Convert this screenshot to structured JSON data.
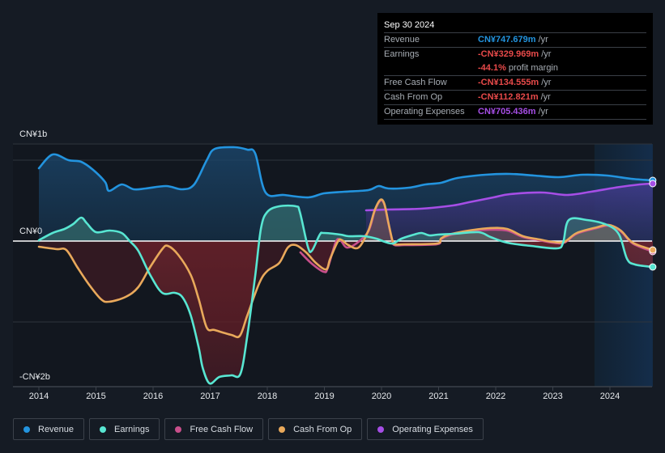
{
  "chart_data": {
    "type": "area",
    "title": "",
    "xlabel": "",
    "ylabel": "",
    "unit": "CN¥ billions",
    "xlim": [
      2014.0,
      2024.8
    ],
    "ylim": [
      -1.8,
      1.2
    ],
    "y_ticks": [
      {
        "value": 1,
        "label": "CN¥1b"
      },
      {
        "value": 0,
        "label": "CN¥0"
      },
      {
        "value": -1.7,
        "label": "-CN¥2b"
      }
    ],
    "gridlines": [
      1.2,
      1.0,
      -1.0
    ],
    "x_ticks": [
      "2014",
      "2015",
      "2016",
      "2017",
      "2018",
      "2019",
      "2020",
      "2021",
      "2022",
      "2023",
      "2024"
    ],
    "highlight_range": [
      2023.73,
      2024.75
    ],
    "legend_position": "bottom-left",
    "series": [
      {
        "name": "Revenue",
        "color": "#2394df",
        "points": [
          [
            2014.0,
            0.9
          ],
          [
            2014.24,
            1.07
          ],
          [
            2014.52,
            1.0
          ],
          [
            2014.74,
            0.98
          ],
          [
            2014.95,
            0.88
          ],
          [
            2015.16,
            0.73
          ],
          [
            2015.23,
            0.62
          ],
          [
            2015.45,
            0.7
          ],
          [
            2015.66,
            0.64
          ],
          [
            2015.87,
            0.65
          ],
          [
            2016.23,
            0.68
          ],
          [
            2016.51,
            0.64
          ],
          [
            2016.72,
            0.7
          ],
          [
            2016.94,
            1.0
          ],
          [
            2017.08,
            1.14
          ],
          [
            2017.43,
            1.16
          ],
          [
            2017.65,
            1.13
          ],
          [
            2017.79,
            1.08
          ],
          [
            2017.97,
            0.6
          ],
          [
            2018.29,
            0.57
          ],
          [
            2018.72,
            0.54
          ],
          [
            2018.99,
            0.59
          ],
          [
            2019.35,
            0.61
          ],
          [
            2019.77,
            0.63
          ],
          [
            2019.95,
            0.68
          ],
          [
            2020.12,
            0.65
          ],
          [
            2020.48,
            0.66
          ],
          [
            2020.77,
            0.7
          ],
          [
            2021.04,
            0.72
          ],
          [
            2021.33,
            0.78
          ],
          [
            2021.82,
            0.82
          ],
          [
            2022.25,
            0.83
          ],
          [
            2022.67,
            0.81
          ],
          [
            2023.1,
            0.79
          ],
          [
            2023.52,
            0.82
          ],
          [
            2023.95,
            0.81
          ],
          [
            2024.37,
            0.77
          ],
          [
            2024.75,
            0.75
          ]
        ]
      },
      {
        "name": "Earnings",
        "color": "#58e6d2",
        "points": [
          [
            2014.0,
            0.01
          ],
          [
            2014.24,
            0.1
          ],
          [
            2014.45,
            0.15
          ],
          [
            2014.6,
            0.21
          ],
          [
            2014.74,
            0.29
          ],
          [
            2014.84,
            0.22
          ],
          [
            2015.0,
            0.11
          ],
          [
            2015.24,
            0.13
          ],
          [
            2015.45,
            0.1
          ],
          [
            2015.59,
            0.0
          ],
          [
            2015.74,
            -0.12
          ],
          [
            2015.95,
            -0.42
          ],
          [
            2016.16,
            -0.64
          ],
          [
            2016.38,
            -0.64
          ],
          [
            2016.52,
            -0.7
          ],
          [
            2016.66,
            -0.92
          ],
          [
            2016.8,
            -1.32
          ],
          [
            2016.87,
            -1.57
          ],
          [
            2016.99,
            -1.76
          ],
          [
            2017.16,
            -1.68
          ],
          [
            2017.37,
            -1.66
          ],
          [
            2017.53,
            -1.64
          ],
          [
            2017.65,
            -1.17
          ],
          [
            2017.79,
            -0.42
          ],
          [
            2017.89,
            0.16
          ],
          [
            2018.0,
            0.36
          ],
          [
            2018.21,
            0.43
          ],
          [
            2018.5,
            0.43
          ],
          [
            2018.57,
            0.36
          ],
          [
            2018.71,
            -0.07
          ],
          [
            2018.78,
            -0.12
          ],
          [
            2018.92,
            0.08
          ],
          [
            2018.99,
            0.1
          ],
          [
            2019.28,
            0.08
          ],
          [
            2019.42,
            0.06
          ],
          [
            2019.7,
            0.06
          ],
          [
            2019.91,
            0.03
          ],
          [
            2020.06,
            -0.01
          ],
          [
            2020.2,
            -0.03
          ],
          [
            2020.35,
            0.03
          ],
          [
            2020.57,
            0.08
          ],
          [
            2020.7,
            0.1
          ],
          [
            2020.84,
            0.07
          ],
          [
            2020.99,
            0.08
          ],
          [
            2021.28,
            0.09
          ],
          [
            2021.7,
            0.11
          ],
          [
            2021.91,
            0.05
          ],
          [
            2022.2,
            -0.02
          ],
          [
            2022.62,
            -0.06
          ],
          [
            2023.07,
            -0.09
          ],
          [
            2023.18,
            -0.02
          ],
          [
            2023.28,
            0.26
          ],
          [
            2023.6,
            0.26
          ],
          [
            2023.95,
            0.2
          ],
          [
            2024.16,
            0.08
          ],
          [
            2024.3,
            -0.22
          ],
          [
            2024.44,
            -0.29
          ],
          [
            2024.75,
            -0.32
          ]
        ]
      },
      {
        "name": "Free Cash Flow",
        "color": "#c84f8b",
        "points": [
          [
            2018.58,
            -0.14
          ],
          [
            2018.78,
            -0.28
          ],
          [
            2018.99,
            -0.38
          ],
          [
            2019.06,
            -0.33
          ],
          [
            2019.2,
            -0.01
          ],
          [
            2019.28,
            0.01
          ],
          [
            2019.39,
            -0.08
          ],
          [
            2019.56,
            -0.03
          ],
          [
            2019.77,
            0.12
          ],
          [
            2019.88,
            0.37
          ],
          [
            2019.98,
            0.5
          ],
          [
            2020.05,
            0.45
          ],
          [
            2020.12,
            0.22
          ],
          [
            2020.19,
            0.0
          ],
          [
            2020.23,
            -0.05
          ],
          [
            2020.4,
            -0.05
          ],
          [
            2020.97,
            -0.04
          ],
          [
            2021.04,
            0.02
          ],
          [
            2021.18,
            0.07
          ],
          [
            2021.53,
            0.12
          ],
          [
            2021.89,
            0.14
          ],
          [
            2022.2,
            0.13
          ],
          [
            2022.48,
            0.05
          ],
          [
            2022.77,
            0.01
          ],
          [
            2022.99,
            -0.02
          ],
          [
            2023.2,
            -0.02
          ],
          [
            2023.42,
            0.09
          ],
          [
            2023.77,
            0.16
          ],
          [
            2023.98,
            0.19
          ],
          [
            2024.19,
            0.12
          ],
          [
            2024.4,
            -0.03
          ],
          [
            2024.75,
            -0.13
          ]
        ]
      },
      {
        "name": "Cash From Op",
        "color": "#e9a95b",
        "points": [
          [
            2014.0,
            -0.07
          ],
          [
            2014.31,
            -0.1
          ],
          [
            2014.48,
            -0.11
          ],
          [
            2014.67,
            -0.32
          ],
          [
            2014.88,
            -0.54
          ],
          [
            2015.09,
            -0.72
          ],
          [
            2015.23,
            -0.75
          ],
          [
            2015.52,
            -0.69
          ],
          [
            2015.74,
            -0.57
          ],
          [
            2015.95,
            -0.32
          ],
          [
            2016.16,
            -0.1
          ],
          [
            2016.26,
            -0.06
          ],
          [
            2016.44,
            -0.17
          ],
          [
            2016.66,
            -0.42
          ],
          [
            2016.8,
            -0.72
          ],
          [
            2016.94,
            -1.07
          ],
          [
            2017.08,
            -1.1
          ],
          [
            2017.37,
            -1.16
          ],
          [
            2017.52,
            -1.17
          ],
          [
            2017.65,
            -0.92
          ],
          [
            2017.86,
            -0.52
          ],
          [
            2018.0,
            -0.37
          ],
          [
            2018.21,
            -0.27
          ],
          [
            2018.36,
            -0.08
          ],
          [
            2018.5,
            -0.05
          ],
          [
            2018.68,
            -0.14
          ],
          [
            2018.85,
            -0.27
          ],
          [
            2019.03,
            -0.35
          ],
          [
            2019.1,
            -0.22
          ],
          [
            2019.24,
            0.0
          ],
          [
            2019.31,
            0.01
          ],
          [
            2019.42,
            -0.05
          ],
          [
            2019.6,
            -0.08
          ],
          [
            2019.77,
            0.13
          ],
          [
            2019.88,
            0.38
          ],
          [
            2019.98,
            0.51
          ],
          [
            2020.05,
            0.46
          ],
          [
            2020.12,
            0.23
          ],
          [
            2020.19,
            0.01
          ],
          [
            2020.23,
            -0.04
          ],
          [
            2020.4,
            -0.04
          ],
          [
            2020.97,
            -0.03
          ],
          [
            2021.04,
            0.03
          ],
          [
            2021.18,
            0.08
          ],
          [
            2021.53,
            0.13
          ],
          [
            2021.89,
            0.16
          ],
          [
            2022.2,
            0.15
          ],
          [
            2022.48,
            0.06
          ],
          [
            2022.77,
            0.02
          ],
          [
            2022.99,
            -0.01
          ],
          [
            2023.2,
            -0.01
          ],
          [
            2023.42,
            0.1
          ],
          [
            2023.77,
            0.17
          ],
          [
            2023.98,
            0.2
          ],
          [
            2024.19,
            0.13
          ],
          [
            2024.4,
            -0.02
          ],
          [
            2024.75,
            -0.11
          ]
        ]
      },
      {
        "name": "Operating Expenses",
        "color": "#a64ee6",
        "points": [
          [
            2019.73,
            0.38
          ],
          [
            2020.12,
            0.39
          ],
          [
            2020.69,
            0.4
          ],
          [
            2021.25,
            0.44
          ],
          [
            2021.53,
            0.48
          ],
          [
            2021.96,
            0.54
          ],
          [
            2022.25,
            0.58
          ],
          [
            2022.82,
            0.6
          ],
          [
            2023.25,
            0.57
          ],
          [
            2023.67,
            0.61
          ],
          [
            2024.09,
            0.66
          ],
          [
            2024.52,
            0.7
          ],
          [
            2024.75,
            0.71
          ]
        ]
      }
    ]
  },
  "axis": {
    "y_top_label": "CN¥1b",
    "y_zero_label": "CN¥0",
    "y_bottom_label": "-CN¥2b",
    "x_labels": [
      "2014",
      "2015",
      "2016",
      "2017",
      "2018",
      "2019",
      "2020",
      "2021",
      "2022",
      "2023",
      "2024"
    ]
  },
  "tooltip": {
    "date": "Sep 30 2024",
    "rows": [
      {
        "label": "Revenue",
        "value": "CN¥747.679m",
        "suffix": "/yr",
        "color": "#2394df"
      },
      {
        "label": "Earnings",
        "value": "-CN¥329.969m",
        "suffix": "/yr",
        "color": "#e84a4a"
      },
      {
        "label": "",
        "value": "-44.1%",
        "suffix": "profit margin",
        "color": "#e84a4a"
      },
      {
        "label": "Free Cash Flow",
        "value": "-CN¥134.555m",
        "suffix": "/yr",
        "color": "#e84a4a"
      },
      {
        "label": "Cash From Op",
        "value": "-CN¥112.821m",
        "suffix": "/yr",
        "color": "#e84a4a"
      },
      {
        "label": "Operating Expenses",
        "value": "CN¥705.436m",
        "suffix": "/yr",
        "color": "#a64ee6"
      }
    ]
  },
  "legend": [
    {
      "label": "Revenue",
      "color": "#2394df"
    },
    {
      "label": "Earnings",
      "color": "#58e6d2"
    },
    {
      "label": "Free Cash Flow",
      "color": "#c84f8b"
    },
    {
      "label": "Cash From Op",
      "color": "#e9a95b"
    },
    {
      "label": "Operating Expenses",
      "color": "#a64ee6"
    }
  ]
}
